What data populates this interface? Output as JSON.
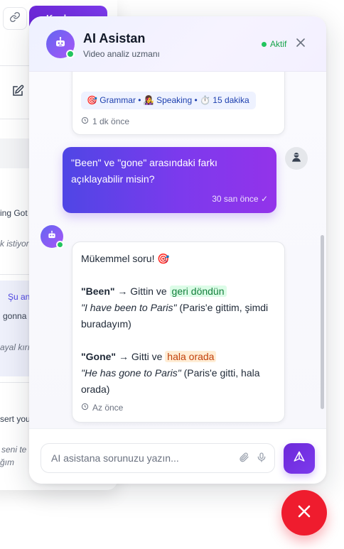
{
  "background_page": {
    "primary_button_label": "K...d...",
    "line_texts": [
      {
        "text": "ing Got",
        "style": "normal"
      },
      {
        "text": "k istiyoru",
        "style": "italic"
      },
      {
        "text": "Şu an",
        "style": "accent"
      },
      {
        "text": "gonna",
        "style": "normal"
      },
      {
        "text": "ayal kırı",
        "style": "italic"
      },
      {
        "text": "sert you",
        "style": "normal"
      },
      {
        "text": "seni te",
        "style": "italic"
      },
      {
        "text": "ğım",
        "style": "italic"
      }
    ]
  },
  "chat": {
    "header": {
      "title": "AI Asistan",
      "subtitle": "Video analiz uzmanı",
      "status": "Aktif",
      "close_icon": "close-icon"
    },
    "messages": [
      {
        "role": "assistant",
        "tags": "🎯 Grammar • 👩‍🎤 Speaking • ⏱️ 15 dakika",
        "time": "1 dk önce"
      },
      {
        "role": "user",
        "text": "\"Been\" ve \"gone\" arasındaki farkı açıklayabilir misin?",
        "time": "30 san önce ✓"
      },
      {
        "role": "assistant",
        "intro": "Mükemmel soru! 🎯",
        "been": {
          "term": "\"Been\"",
          "arrow": " → Gittin ve ",
          "highlight": "geri döndün",
          "example": "\"I have been to Paris\"",
          "translation": " (Paris'e gittim, şimdi buradayım)"
        },
        "gone": {
          "term": "\"Gone\"",
          "arrow": " → Gitti ve ",
          "highlight": "hala orada",
          "example": "\"He has gone to Paris\"",
          "translation": " (Paris'e gitti, hala orada)"
        },
        "time": "Az önce"
      }
    ],
    "input": {
      "placeholder": "AI asistana sorunuzu yazın...",
      "value": ""
    }
  },
  "colors": {
    "accent": "#7c3aed",
    "online": "#22c55e",
    "danger": "#ef1c2e",
    "highlight_green": "#15803d",
    "highlight_orange": "#c2410c"
  },
  "icons": [
    "link-icon",
    "edit-icon",
    "robot-icon",
    "user-icon",
    "clock-icon",
    "paperclip-icon",
    "microphone-icon",
    "send-icon",
    "close-icon"
  ]
}
